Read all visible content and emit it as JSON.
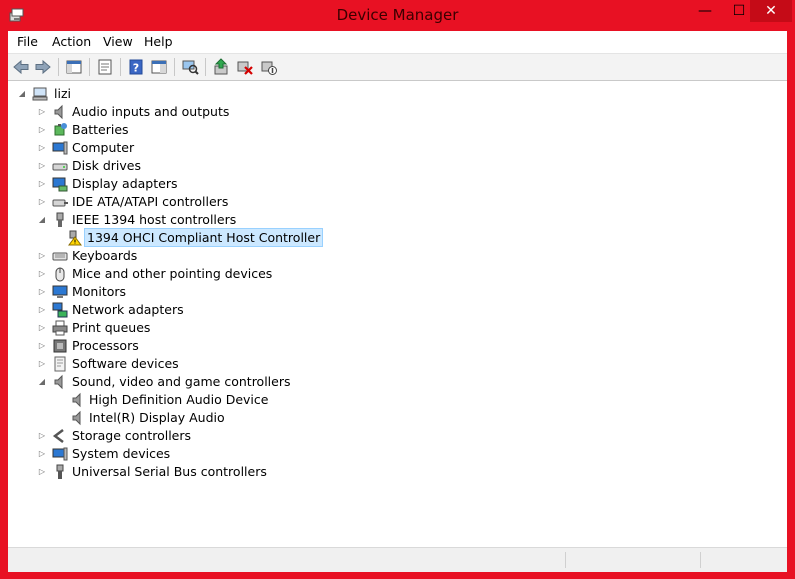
{
  "window": {
    "title": "Device Manager",
    "minimize": "—",
    "maximize": "☐",
    "close": "✕"
  },
  "menu": [
    {
      "label": "File"
    },
    {
      "label": "Action"
    },
    {
      "label": "View"
    },
    {
      "label": "Help"
    }
  ],
  "toolbar": {
    "icons": [
      "back-arrow-icon",
      "forward-arrow-icon",
      "show-hide-console-tree-icon",
      "properties-icon",
      "help-icon",
      "action-pane-icon",
      "scan-hardware-icon",
      "update-driver-icon",
      "uninstall-device-icon",
      "disable-device-icon"
    ]
  },
  "tree": {
    "root": "lizi",
    "categories": [
      {
        "label": "Audio inputs and outputs",
        "icon": "speaker-icon",
        "expanded": false
      },
      {
        "label": "Batteries",
        "icon": "battery-icon",
        "expanded": false
      },
      {
        "label": "Computer",
        "icon": "computer-icon",
        "expanded": false
      },
      {
        "label": "Disk drives",
        "icon": "disk-drive-icon",
        "expanded": false
      },
      {
        "label": "Display adapters",
        "icon": "display-adapter-icon",
        "expanded": false
      },
      {
        "label": "IDE ATA/ATAPI controllers",
        "icon": "ide-controller-icon",
        "expanded": false
      },
      {
        "label": "IEEE 1394 host controllers",
        "icon": "ieee1394-icon",
        "expanded": true,
        "children": [
          {
            "label": "1394 OHCI Compliant Host Controller",
            "icon": "warning-device-icon",
            "selected": true
          }
        ]
      },
      {
        "label": "Keyboards",
        "icon": "keyboard-icon",
        "expanded": false
      },
      {
        "label": "Mice and other pointing devices",
        "icon": "mouse-icon",
        "expanded": false
      },
      {
        "label": "Monitors",
        "icon": "monitor-icon",
        "expanded": false
      },
      {
        "label": "Network adapters",
        "icon": "network-adapter-icon",
        "expanded": false
      },
      {
        "label": "Print queues",
        "icon": "printer-icon",
        "expanded": false
      },
      {
        "label": "Processors",
        "icon": "processor-icon",
        "expanded": false
      },
      {
        "label": "Software devices",
        "icon": "software-device-icon",
        "expanded": false
      },
      {
        "label": "Sound, video and game controllers",
        "icon": "speaker-icon",
        "expanded": true,
        "children": [
          {
            "label": "High Definition Audio Device",
            "icon": "speaker-icon"
          },
          {
            "label": "Intel(R) Display Audio",
            "icon": "speaker-icon"
          }
        ]
      },
      {
        "label": "Storage controllers",
        "icon": "storage-controller-icon",
        "expanded": false
      },
      {
        "label": "System devices",
        "icon": "system-device-icon",
        "expanded": false
      },
      {
        "label": "Universal Serial Bus controllers",
        "icon": "usb-icon",
        "expanded": false
      }
    ]
  },
  "colors": {
    "frame": "#e81123",
    "selection": "#cce8ff",
    "selection_border": "#99d1ff"
  }
}
